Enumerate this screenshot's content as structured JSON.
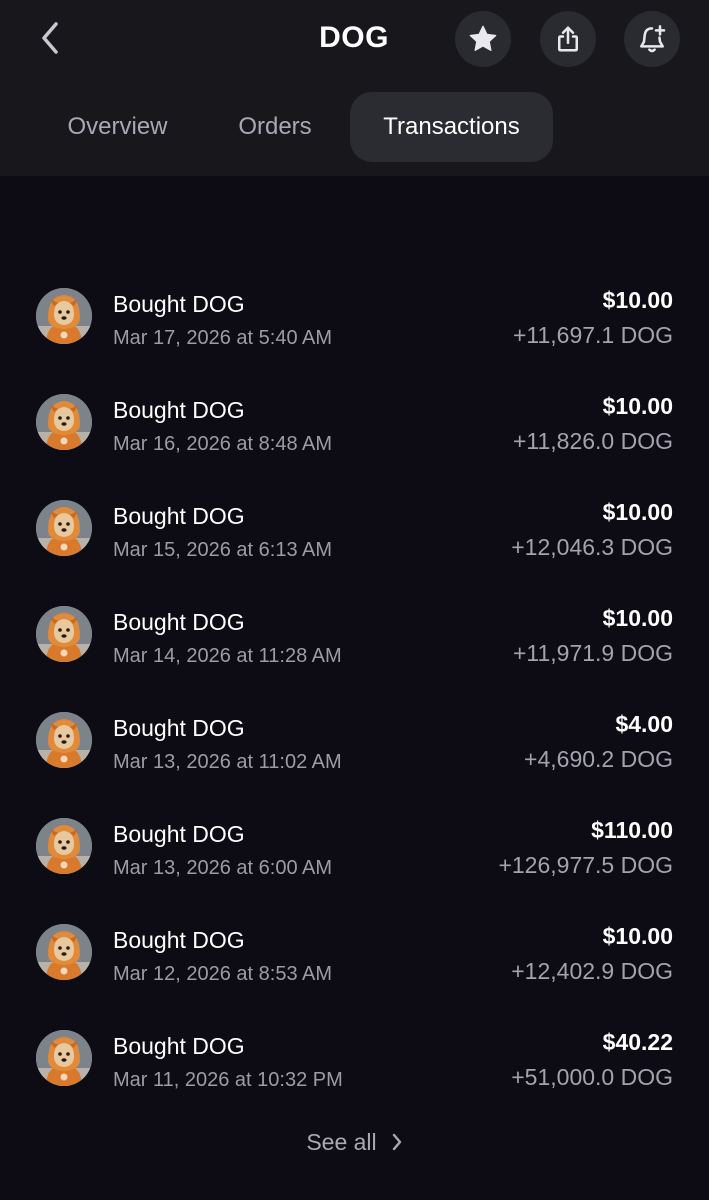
{
  "header": {
    "title": "DOG",
    "back_icon": "chevron-left-icon",
    "actions": [
      "star-icon",
      "share-icon",
      "bell-plus-icon"
    ]
  },
  "tabs": [
    {
      "label": "Overview",
      "active": false
    },
    {
      "label": "Orders",
      "active": false
    },
    {
      "label": "Transactions",
      "active": true
    }
  ],
  "transactions": [
    {
      "title": "Bought DOG",
      "date": "Mar 17, 2026 at 5:40 AM",
      "amount": "$10.00",
      "quantity": "+11,697.1 DOG"
    },
    {
      "title": "Bought DOG",
      "date": "Mar 16, 2026 at 8:48 AM",
      "amount": "$10.00",
      "quantity": "+11,826.0 DOG"
    },
    {
      "title": "Bought DOG",
      "date": "Mar 15, 2026 at 6:13 AM",
      "amount": "$10.00",
      "quantity": "+12,046.3 DOG"
    },
    {
      "title": "Bought DOG",
      "date": "Mar 14, 2026 at 11:28 AM",
      "amount": "$10.00",
      "quantity": "+11,971.9 DOG"
    },
    {
      "title": "Bought DOG",
      "date": "Mar 13, 2026 at 11:02 AM",
      "amount": "$4.00",
      "quantity": "+4,690.2 DOG"
    },
    {
      "title": "Bought DOG",
      "date": "Mar 13, 2026 at 6:00 AM",
      "amount": "$110.00",
      "quantity": "+126,977.5 DOG"
    },
    {
      "title": "Bought DOG",
      "date": "Mar 12, 2026 at 8:53 AM",
      "amount": "$10.00",
      "quantity": "+12,402.9 DOG"
    },
    {
      "title": "Bought DOG",
      "date": "Mar 11, 2026 at 10:32 PM",
      "amount": "$40.22",
      "quantity": "+51,000.0 DOG"
    }
  ],
  "see_all": {
    "label": "See all",
    "icon": "chevron-right-icon"
  },
  "colors": {
    "background": "#0d0c15",
    "header_bg": "#17171c",
    "active_tab_bg": "#2b2b32",
    "muted_text": "#9c9ca8",
    "hood_orange": "#e08a3a"
  }
}
